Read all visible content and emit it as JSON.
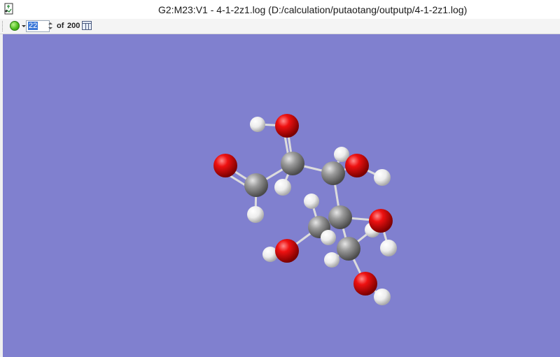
{
  "window": {
    "title": "G2:M23:V1 - 4-1-2z1.log (D:/calculation/putaotang/outputp/4-1-2z1.log)"
  },
  "toolbar": {
    "frame_value": "22",
    "of_label": "of",
    "total_frames": "200",
    "icons": [
      "app-icon",
      "play-icon",
      "dropdown-arrow-icon",
      "spinner-icon",
      "table-icon"
    ]
  },
  "viewport": {
    "background_color": "#8080cf",
    "atom_colors": {
      "oxygen": "#e00000",
      "carbon": "#8c8c8c",
      "hydrogen": "#f2f2f2",
      "bond": "#d8d8d8"
    }
  }
}
